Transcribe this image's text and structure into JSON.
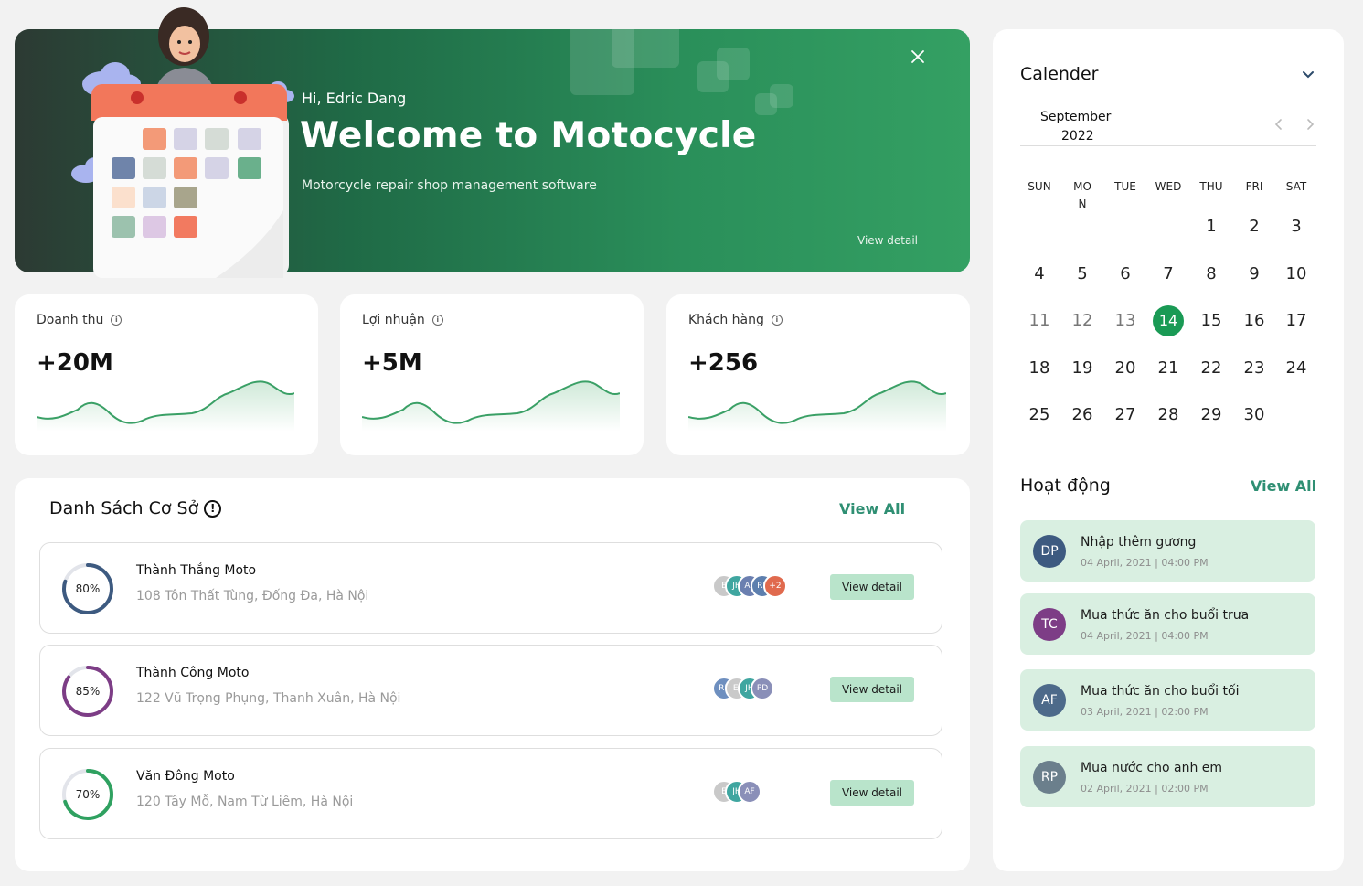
{
  "banner": {
    "greeting": "Hi,  Edric Dang",
    "title": "Welcome to Motocycle",
    "subtitle": "Motorcycle repair shop management software",
    "view_detail": "View detail",
    "close_icon": "close-icon"
  },
  "stats": [
    {
      "label": "Doanh thu",
      "value": "+20M"
    },
    {
      "label": "Lợi nhuận",
      "value": "+5M"
    },
    {
      "label": "Khách hàng",
      "value": "+256"
    }
  ],
  "list": {
    "title": "Danh Sách Cơ Sở",
    "view_all": "View All",
    "rows": [
      {
        "percent": 80,
        "percent_label": "80%",
        "ring_color": "#3d5a80",
        "name": "Thành Thắng Moto",
        "address": "108 Tôn Thất Tùng, Đống Đa, Hà Nội",
        "avatars": [
          {
            "t": "E",
            "c": "#c9c9c9"
          },
          {
            "t": "JH",
            "c": "#3fa6a0"
          },
          {
            "t": "AF",
            "c": "#6b7fb0"
          },
          {
            "t": "RP",
            "c": "#5d7fae"
          },
          {
            "t": "+2",
            "c": "#e06a4e"
          }
        ],
        "button": "View detail"
      },
      {
        "percent": 85,
        "percent_label": "85%",
        "ring_color": "#7d3d86",
        "name": "Thành Công Moto",
        "address": "122 Vũ Trọng Phụng, Thanh Xuân, Hà Nội",
        "avatars": [
          {
            "t": "RP",
            "c": "#6e8fbf"
          },
          {
            "t": "EI",
            "c": "#c9c9c9"
          },
          {
            "t": "JH",
            "c": "#3fa6a0"
          },
          {
            "t": "PD",
            "c": "#8a8fb8"
          }
        ],
        "button": "View detail"
      },
      {
        "percent": 70,
        "percent_label": "70%",
        "ring_color": "#2fa160",
        "name": "Văn Đông Moto",
        "address": "120 Tây Mỗ, Nam Từ Liêm, Hà Nội",
        "avatars": [
          {
            "t": "E",
            "c": "#c9c9c9"
          },
          {
            "t": "JH",
            "c": "#3fa6a0"
          },
          {
            "t": "AF",
            "c": "#8a8fb8"
          }
        ],
        "button": "View detail"
      }
    ]
  },
  "calendar": {
    "title": "Calender",
    "month": "September",
    "year": "2022",
    "weekdays": [
      "SUN",
      "MO\nN",
      "TUE",
      "WED",
      "THU",
      "FRI",
      "SAT"
    ],
    "first_weekday": 4,
    "days_in_month": 30,
    "today": 14
  },
  "activity": {
    "title": "Hoạt động",
    "view_all": "View All",
    "items": [
      {
        "initials": "ĐP",
        "color": "#3d5a80",
        "text": "Nhập thêm gương",
        "date": "04 April, 2021 | 04:00 PM"
      },
      {
        "initials": "TC",
        "color": "#7d3d86",
        "text": "Mua thức ăn cho buổi trưa",
        "date": "04 April, 2021 | 04:00 PM"
      },
      {
        "initials": "AF",
        "color": "#4d6a8a",
        "text": "Mua thức ăn cho buổi tối",
        "date": "03 April, 2021 | 02:00 PM"
      },
      {
        "initials": "RP",
        "color": "#6b7f8c",
        "text": "Mua nước cho anh em",
        "date": "02 April, 2021 | 02:00 PM"
      }
    ]
  }
}
